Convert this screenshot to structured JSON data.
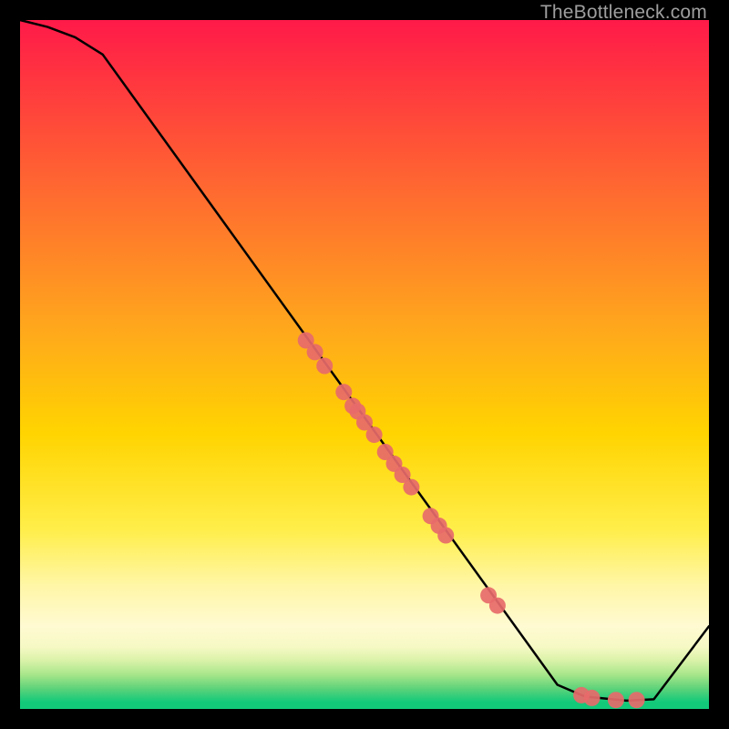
{
  "watermark": "TheBottleneck.com",
  "chart_data": {
    "type": "line",
    "title": "",
    "xlabel": "",
    "ylabel": "",
    "xlim": [
      0,
      100
    ],
    "ylim": [
      0,
      100
    ],
    "grid": false,
    "legend": false,
    "series": [
      {
        "name": "curve",
        "x": [
          0,
          4,
          8,
          12,
          78,
          82,
          88,
          92,
          100
        ],
        "y": [
          100,
          99,
          97.5,
          95,
          3.5,
          1.8,
          1.2,
          1.4,
          12
        ]
      }
    ],
    "points": {
      "name": "markers",
      "color": "#e76a6a",
      "radius_px": 9,
      "xy": [
        [
          41.5,
          53.5
        ],
        [
          42.8,
          51.8
        ],
        [
          44.2,
          49.8
        ],
        [
          47.0,
          46.0
        ],
        [
          48.3,
          44.0
        ],
        [
          49.0,
          43.2
        ],
        [
          50.0,
          41.6
        ],
        [
          51.4,
          39.8
        ],
        [
          53.0,
          37.3
        ],
        [
          54.3,
          35.6
        ],
        [
          55.5,
          34.0
        ],
        [
          56.8,
          32.2
        ],
        [
          59.6,
          28.0
        ],
        [
          60.8,
          26.6
        ],
        [
          61.8,
          25.2
        ],
        [
          68.0,
          16.5
        ],
        [
          69.3,
          15.0
        ],
        [
          81.5,
          2.0
        ],
        [
          83.0,
          1.6
        ],
        [
          86.5,
          1.3
        ],
        [
          89.5,
          1.3
        ]
      ]
    }
  }
}
